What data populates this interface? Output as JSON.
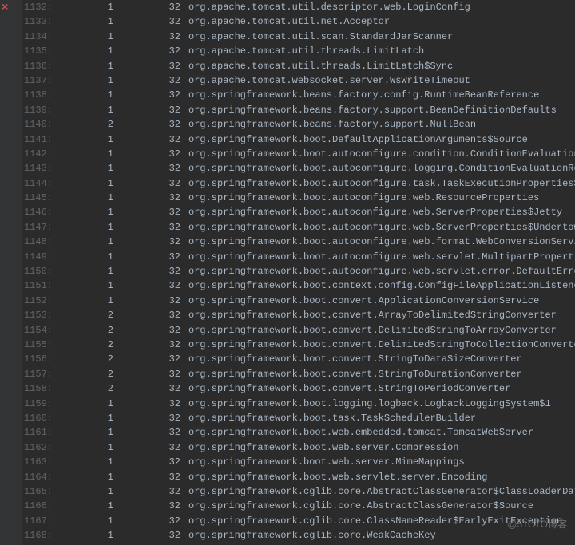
{
  "watermark": "@51CTO博客",
  "rows": [
    {
      "line": "1132:",
      "c1": "1",
      "c2": "32",
      "class": "org.apache.tomcat.util.descriptor.web.LoginConfig"
    },
    {
      "line": "1133:",
      "c1": "1",
      "c2": "32",
      "class": "org.apache.tomcat.util.net.Acceptor"
    },
    {
      "line": "1134:",
      "c1": "1",
      "c2": "32",
      "class": "org.apache.tomcat.util.scan.StandardJarScanner"
    },
    {
      "line": "1135:",
      "c1": "1",
      "c2": "32",
      "class": "org.apache.tomcat.util.threads.LimitLatch"
    },
    {
      "line": "1136:",
      "c1": "1",
      "c2": "32",
      "class": "org.apache.tomcat.util.threads.LimitLatch$Sync"
    },
    {
      "line": "1137:",
      "c1": "1",
      "c2": "32",
      "class": "org.apache.tomcat.websocket.server.WsWriteTimeout"
    },
    {
      "line": "1138:",
      "c1": "1",
      "c2": "32",
      "class": "org.springframework.beans.factory.config.RuntimeBeanReference"
    },
    {
      "line": "1139:",
      "c1": "1",
      "c2": "32",
      "class": "org.springframework.beans.factory.support.BeanDefinitionDefaults"
    },
    {
      "line": "1140:",
      "c1": "2",
      "c2": "32",
      "class": "org.springframework.beans.factory.support.NullBean"
    },
    {
      "line": "1141:",
      "c1": "1",
      "c2": "32",
      "class": "org.springframework.boot.DefaultApplicationArguments$Source"
    },
    {
      "line": "1142:",
      "c1": "1",
      "c2": "32",
      "class": "org.springframework.boot.autoconfigure.condition.ConditionEvaluationReport"
    },
    {
      "line": "1143:",
      "c1": "1",
      "c2": "32",
      "class": "org.springframework.boot.autoconfigure.logging.ConditionEvaluationReportLoggingListener"
    },
    {
      "line": "1144:",
      "c1": "1",
      "c2": "32",
      "class": "org.springframework.boot.autoconfigure.task.TaskExecutionProperties$Pool"
    },
    {
      "line": "1145:",
      "c1": "1",
      "c2": "32",
      "class": "org.springframework.boot.autoconfigure.web.ResourceProperties"
    },
    {
      "line": "1146:",
      "c1": "1",
      "c2": "32",
      "class": "org.springframework.boot.autoconfigure.web.ServerProperties$Jetty"
    },
    {
      "line": "1147:",
      "c1": "1",
      "c2": "32",
      "class": "org.springframework.boot.autoconfigure.web.ServerProperties$Undertow$Accesslog"
    },
    {
      "line": "1148:",
      "c1": "1",
      "c2": "32",
      "class": "org.springframework.boot.autoconfigure.web.format.WebConversionService"
    },
    {
      "line": "1149:",
      "c1": "1",
      "c2": "32",
      "class": "org.springframework.boot.autoconfigure.web.servlet.MultipartProperties"
    },
    {
      "line": "1150:",
      "c1": "1",
      "c2": "32",
      "class": "org.springframework.boot.autoconfigure.web.servlet.error.DefaultErrorViewResolver"
    },
    {
      "line": "1151:",
      "c1": "1",
      "c2": "32",
      "class": "org.springframework.boot.context.config.ConfigFileApplicationListener"
    },
    {
      "line": "1152:",
      "c1": "1",
      "c2": "32",
      "class": "org.springframework.boot.convert.ApplicationConversionService"
    },
    {
      "line": "1153:",
      "c1": "2",
      "c2": "32",
      "class": "org.springframework.boot.convert.ArrayToDelimitedStringConverter"
    },
    {
      "line": "1154:",
      "c1": "2",
      "c2": "32",
      "class": "org.springframework.boot.convert.DelimitedStringToArrayConverter"
    },
    {
      "line": "1155:",
      "c1": "2",
      "c2": "32",
      "class": "org.springframework.boot.convert.DelimitedStringToCollectionConverter"
    },
    {
      "line": "1156:",
      "c1": "2",
      "c2": "32",
      "class": "org.springframework.boot.convert.StringToDataSizeConverter"
    },
    {
      "line": "1157:",
      "c1": "2",
      "c2": "32",
      "class": "org.springframework.boot.convert.StringToDurationConverter"
    },
    {
      "line": "1158:",
      "c1": "2",
      "c2": "32",
      "class": "org.springframework.boot.convert.StringToPeriodConverter"
    },
    {
      "line": "1159:",
      "c1": "1",
      "c2": "32",
      "class": "org.springframework.boot.logging.logback.LogbackLoggingSystem$1"
    },
    {
      "line": "1160:",
      "c1": "1",
      "c2": "32",
      "class": "org.springframework.boot.task.TaskSchedulerBuilder"
    },
    {
      "line": "1161:",
      "c1": "1",
      "c2": "32",
      "class": "org.springframework.boot.web.embedded.tomcat.TomcatWebServer"
    },
    {
      "line": "1162:",
      "c1": "1",
      "c2": "32",
      "class": "org.springframework.boot.web.server.Compression"
    },
    {
      "line": "1163:",
      "c1": "1",
      "c2": "32",
      "class": "org.springframework.boot.web.server.MimeMappings"
    },
    {
      "line": "1164:",
      "c1": "1",
      "c2": "32",
      "class": "org.springframework.boot.web.servlet.server.Encoding"
    },
    {
      "line": "1165:",
      "c1": "1",
      "c2": "32",
      "class": "org.springframework.cglib.core.AbstractClassGenerator$ClassLoaderData"
    },
    {
      "line": "1166:",
      "c1": "1",
      "c2": "32",
      "class": "org.springframework.cglib.core.AbstractClassGenerator$Source"
    },
    {
      "line": "1167:",
      "c1": "1",
      "c2": "32",
      "class": "org.springframework.cglib.core.ClassNameReader$EarlyExitException"
    },
    {
      "line": "1168:",
      "c1": "1",
      "c2": "32",
      "class": "org.springframework.cglib.core.WeakCacheKey"
    }
  ]
}
